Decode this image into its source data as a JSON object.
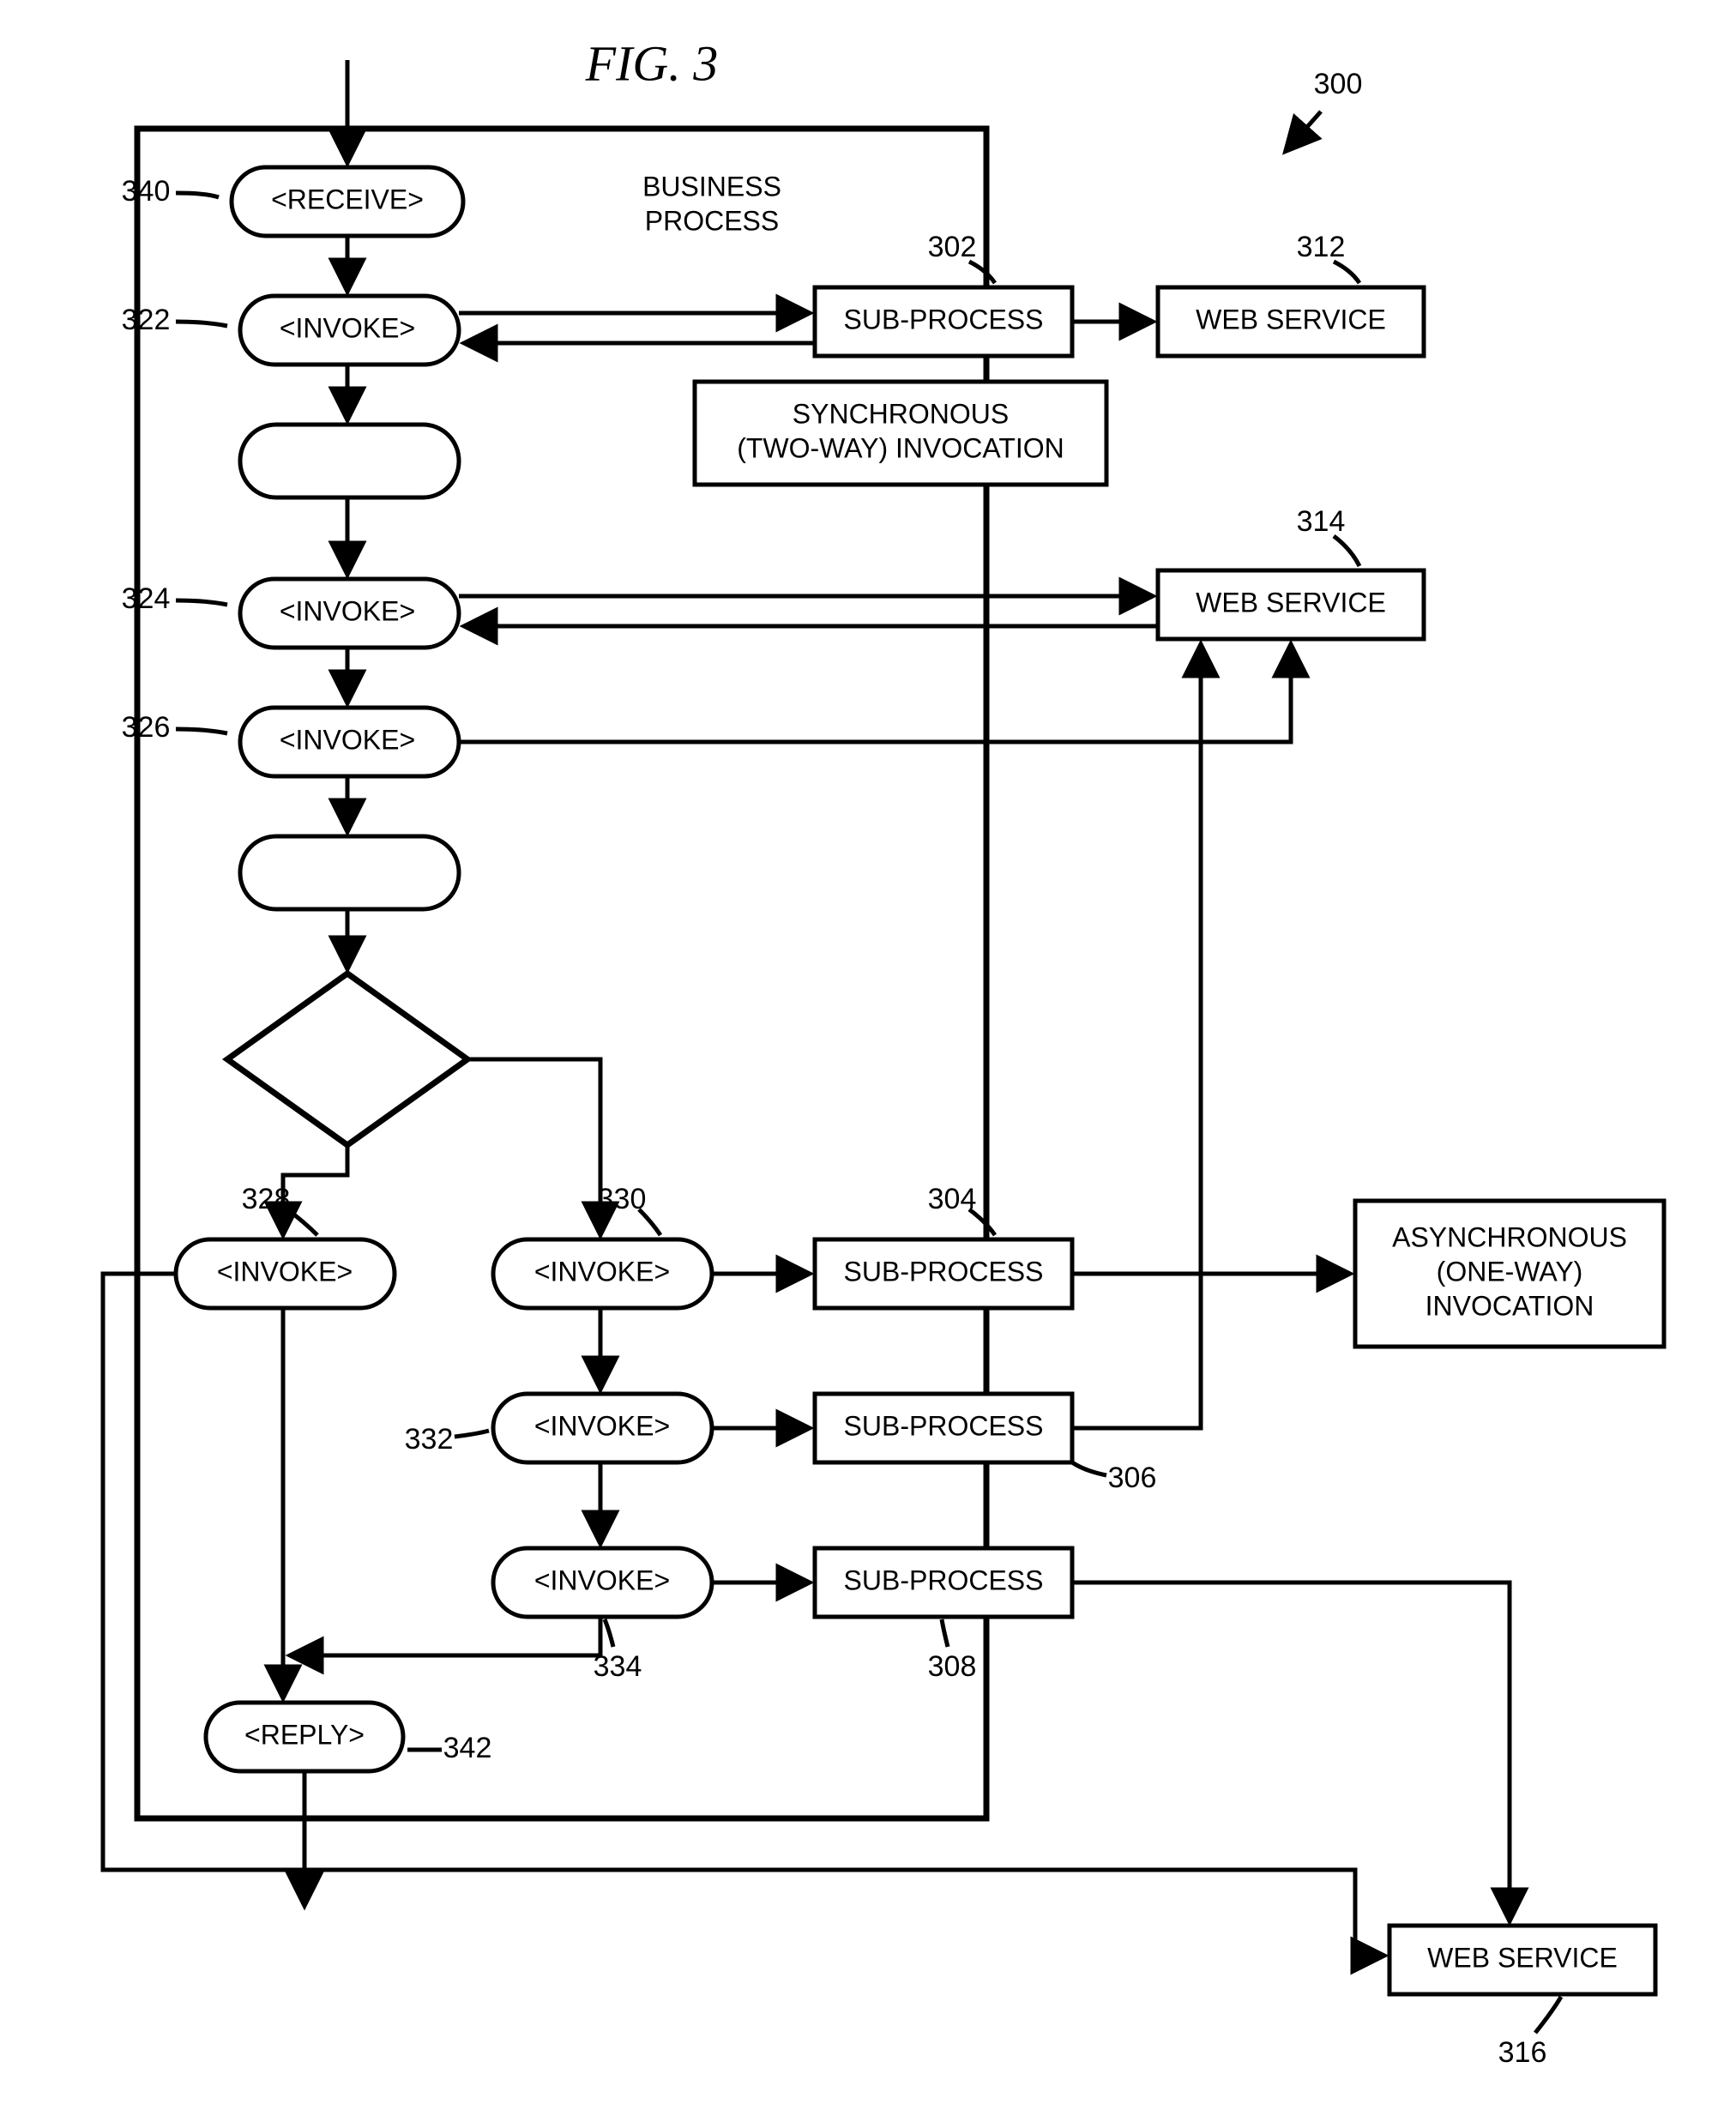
{
  "title": "FIG. 3",
  "labels": {
    "businessProcess": "BUSINESS\nPROCESS",
    "receive": "<RECEIVE>",
    "invoke": "<INVOKE>",
    "reply": "<REPLY>",
    "subProcess": "SUB-PROCESS",
    "webService": "WEB SERVICE",
    "syncInvocation": "SYNCHRONOUS\n(TWO-WAY) INVOCATION",
    "asyncInvocation": "ASYNCHRONOUS\n(ONE-WAY)\nINVOCATION"
  },
  "refs": {
    "r300": "300",
    "r302": "302",
    "r304": "304",
    "r306": "306",
    "r308": "308",
    "r312": "312",
    "r314": "314",
    "r316": "316",
    "r322": "322",
    "r324": "324",
    "r326": "326",
    "r328": "328",
    "r330": "330",
    "r332": "332",
    "r334": "334",
    "r340": "340",
    "r342": "342"
  }
}
